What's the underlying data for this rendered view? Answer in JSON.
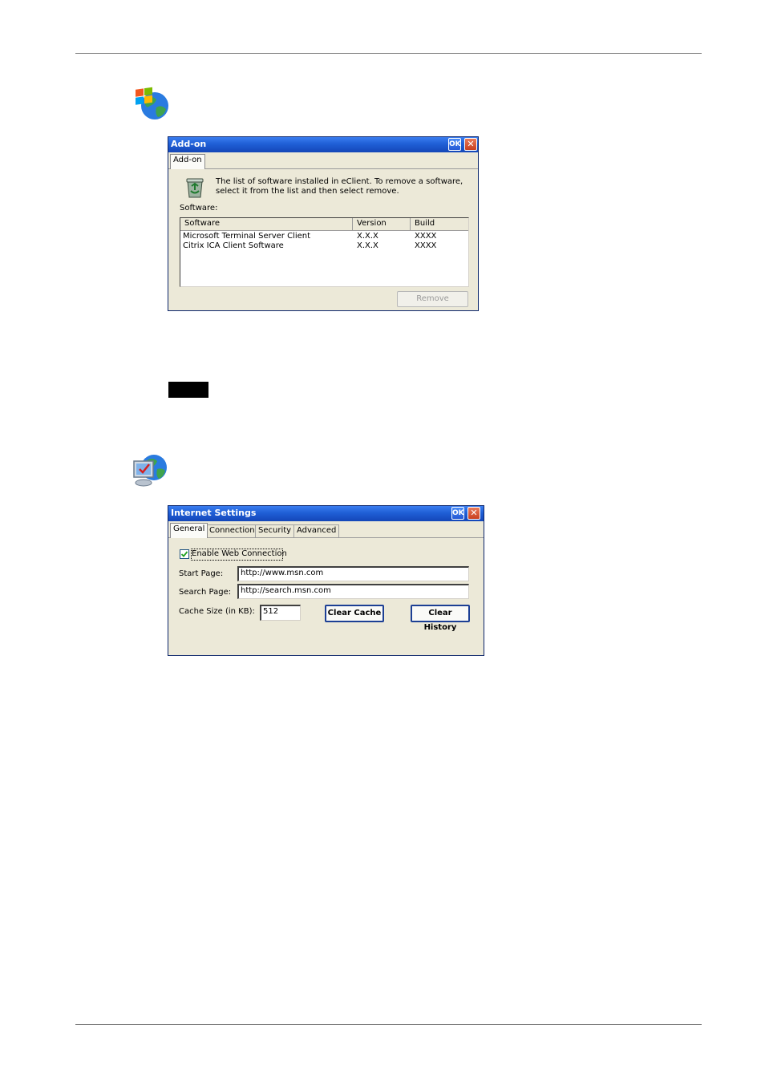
{
  "addon_window": {
    "title": "Add-on",
    "ok_label": "OK",
    "close_label": "✕",
    "tab": "Add-on",
    "description_line1": "The list of software installed in eClient. To remove a software,",
    "description_line2": "select it from the list and then select remove.",
    "software_label": "Software:",
    "columns": [
      "Software",
      "Version",
      "Build"
    ],
    "rows": [
      [
        "Microsoft Terminal Server Client",
        "X.X.X",
        "XXXX"
      ],
      [
        "Citrix ICA Client Software",
        "X.X.X",
        "XXXX"
      ]
    ],
    "remove_label": "Remove"
  },
  "internet_window": {
    "title": "Internet Settings",
    "ok_label": "OK",
    "close_label": "✕",
    "tabs": [
      "General",
      "Connection",
      "Security",
      "Advanced"
    ],
    "active_tab": "General",
    "enable_label": "Enable Web Connection",
    "enable_checked": true,
    "start_page_label": "Start Page:",
    "start_page_value": "http://www.msn.com",
    "search_page_label": "Search Page:",
    "search_page_value": "http://search.msn.com",
    "cache_size_label": "Cache Size (in KB):",
    "cache_size_value": "512",
    "clear_cache_label": "Clear Cache",
    "clear_history_label": "Clear History"
  },
  "icons": {
    "section1": "windows-globe-icon",
    "section2": "internet-settings-globe-icon"
  }
}
